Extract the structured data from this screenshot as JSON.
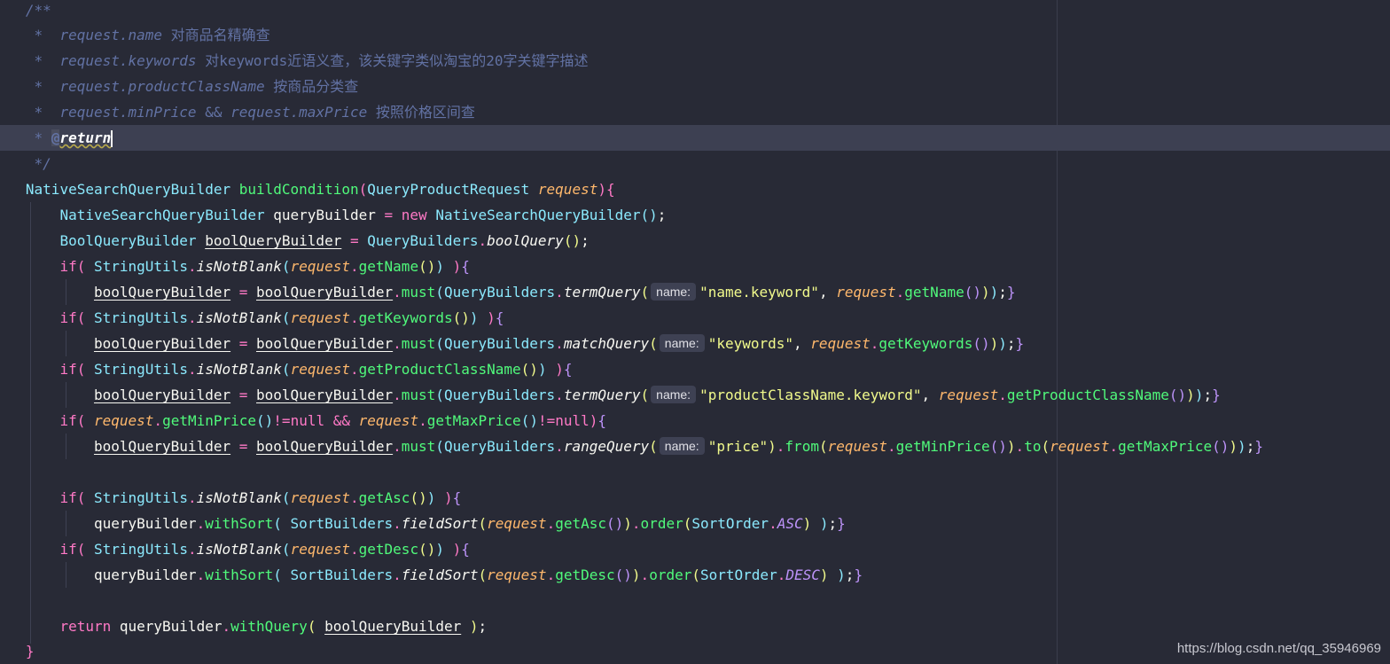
{
  "code": {
    "l1": {
      "open": "/**"
    },
    "l2": {
      "star": " *  ",
      "ref": "request.name",
      "text": " 对商品名精确查"
    },
    "l3": {
      "star": " *  ",
      "ref": "request.keywords",
      "text": " 对keywords近语义查，该关键字类似淘宝的20字关键字描述"
    },
    "l4": {
      "star": " *  ",
      "ref": "request.productClassName",
      "text": " 按商品分类查"
    },
    "l5": {
      "star": " *  ",
      "ref1": "request.minPrice",
      "amp": " && ",
      "ref2": "request.maxPrice",
      "text": " 按照价格区间查"
    },
    "l6": {
      "star": " * ",
      "at": "@",
      "tag": "return"
    },
    "l7": {
      "close": " */"
    },
    "l8": {
      "type": "NativeSearchQueryBuilder",
      "method": "buildCondition",
      "ptype": "QueryProductRequest",
      "param": "request"
    },
    "l9": {
      "type": "NativeSearchQueryBuilder",
      "var": "queryBuilder",
      "kw": "new",
      "ctor": "NativeSearchQueryBuilder"
    },
    "l10": {
      "type": "BoolQueryBuilder",
      "var": "boolQueryBuilder",
      "cls": "QueryBuilders",
      "m": "boolQuery"
    },
    "l11": {
      "kw": "if",
      "cls": "StringUtils",
      "m": "isNotBlank",
      "obj": "request",
      "g": "getName"
    },
    "l12": {
      "v1": "boolQueryBuilder",
      "v2": "boolQueryBuilder",
      "must": "must",
      "cls": "QueryBuilders",
      "m": "termQuery",
      "hint": "name:",
      "str": "\"name.keyword\"",
      "obj": "request",
      "g": "getName"
    },
    "l13": {
      "kw": "if",
      "cls": "StringUtils",
      "m": "isNotBlank",
      "obj": "request",
      "g": "getKeywords"
    },
    "l14": {
      "v1": "boolQueryBuilder",
      "v2": "boolQueryBuilder",
      "must": "must",
      "cls": "QueryBuilders",
      "m": "matchQuery",
      "hint": "name:",
      "str": "\"keywords\"",
      "obj": "request",
      "g": "getKeywords"
    },
    "l15": {
      "kw": "if",
      "cls": "StringUtils",
      "m": "isNotBlank",
      "obj": "request",
      "g": "getProductClassName"
    },
    "l16": {
      "v1": "boolQueryBuilder",
      "v2": "boolQueryBuilder",
      "must": "must",
      "cls": "QueryBuilders",
      "m": "termQuery",
      "hint": "name:",
      "str": "\"productClassName.keyword\"",
      "obj": "request",
      "g": "getProductClassName"
    },
    "l17": {
      "kw": "if",
      "obj1": "request",
      "g1": "getMinPrice",
      "null1": "null",
      "amp": "&&",
      "obj2": "request",
      "g2": "getMaxPrice",
      "null2": "null"
    },
    "l18": {
      "v1": "boolQueryBuilder",
      "v2": "boolQueryBuilder",
      "must": "must",
      "cls": "QueryBuilders",
      "m": "rangeQuery",
      "hint": "name:",
      "str": "\"price\"",
      "from": "from",
      "obj1": "request",
      "g1": "getMinPrice",
      "to": "to",
      "obj2": "request",
      "g2": "getMaxPrice"
    },
    "l20": {
      "kw": "if",
      "cls": "StringUtils",
      "m": "isNotBlank",
      "obj": "request",
      "g": "getAsc"
    },
    "l21": {
      "var": "queryBuilder",
      "m": "withSort",
      "cls": "SortBuilders",
      "m2": "fieldSort",
      "obj": "request",
      "g": "getAsc",
      "order": "order",
      "enumc": "SortOrder",
      "cst": "ASC"
    },
    "l22": {
      "kw": "if",
      "cls": "StringUtils",
      "m": "isNotBlank",
      "obj": "request",
      "g": "getDesc"
    },
    "l23": {
      "var": "queryBuilder",
      "m": "withSort",
      "cls": "SortBuilders",
      "m2": "fieldSort",
      "obj": "request",
      "g": "getDesc",
      "order": "order",
      "enumc": "SortOrder",
      "cst": "DESC"
    },
    "l25": {
      "kw": "return",
      "var": "queryBuilder",
      "m": "withQuery",
      "arg": "boolQueryBuilder"
    },
    "l26": {
      "close": "}"
    }
  },
  "watermark": "https://blog.csdn.net/qq_35946969"
}
